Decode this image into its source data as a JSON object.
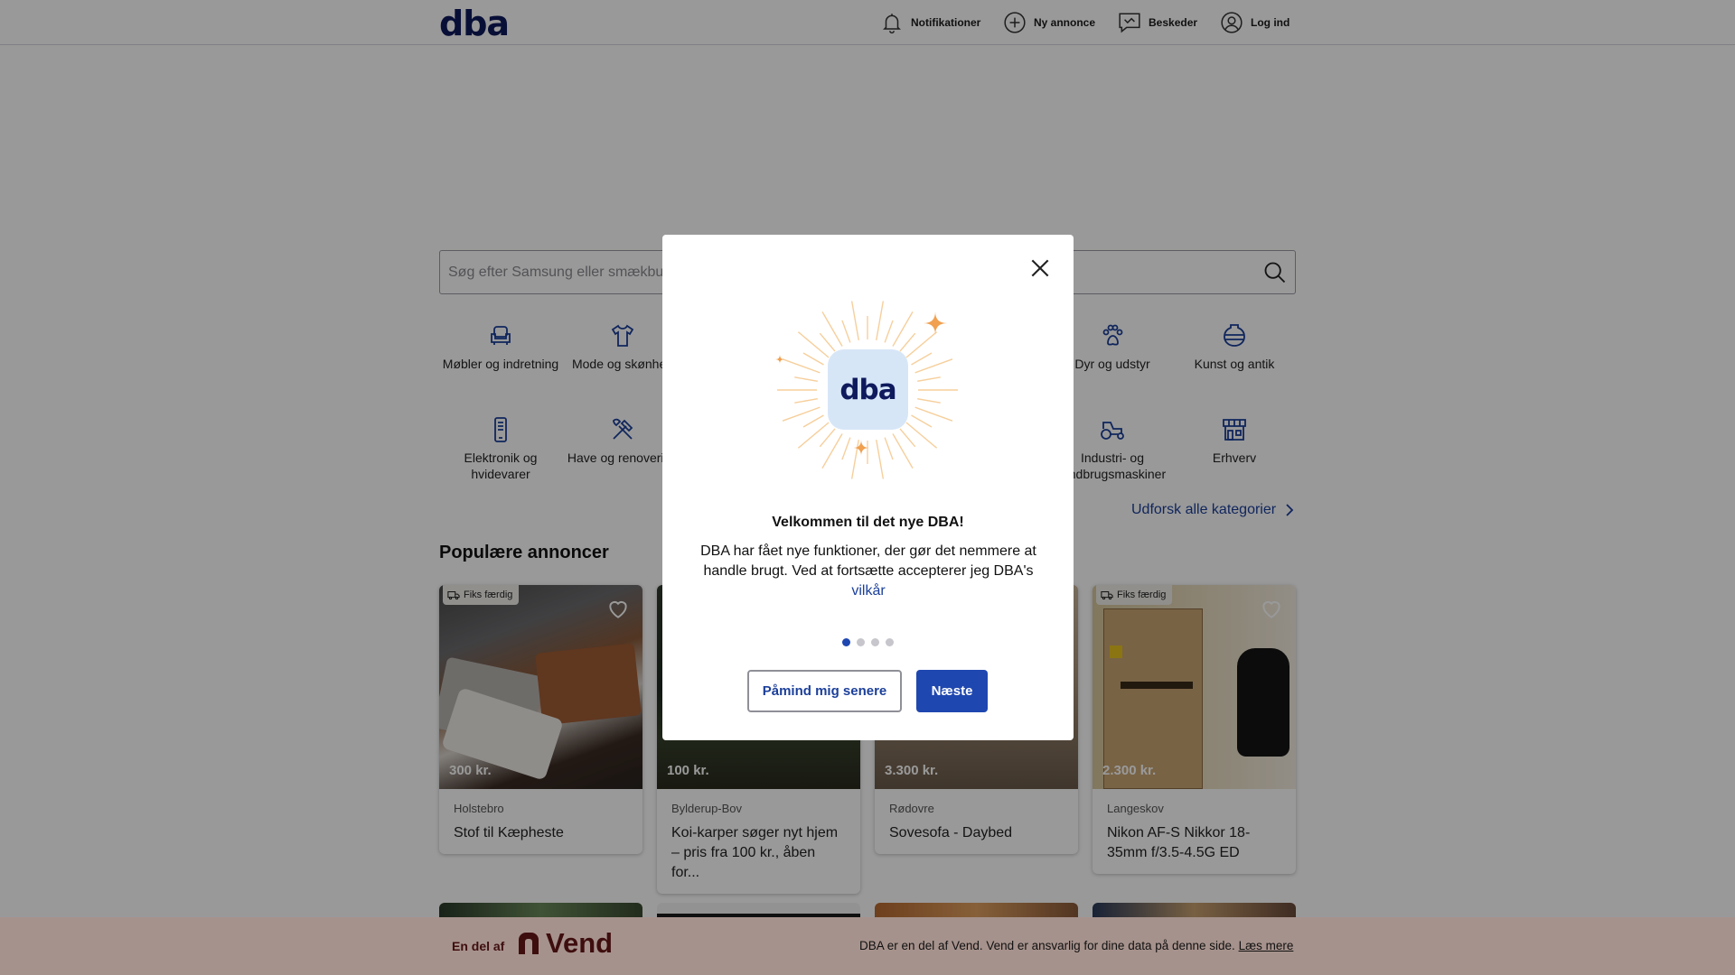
{
  "header": {
    "logo": "dba",
    "nav": [
      {
        "label": "Notifikationer",
        "icon": "bell-icon"
      },
      {
        "label": "Ny annonce",
        "icon": "plus-circle-icon"
      },
      {
        "label": "Beskeder",
        "icon": "message-icon"
      },
      {
        "label": "Log ind",
        "icon": "user-icon"
      }
    ]
  },
  "search": {
    "placeholder": "Søg efter Samsung eller smækbukser"
  },
  "categories": [
    {
      "label": "Møbler og indretning",
      "icon": "armchair-icon"
    },
    {
      "label": "Mode og skønhed",
      "icon": "tshirt-icon"
    },
    {
      "label": "Dyr og udstyr",
      "icon": "paw-icon"
    },
    {
      "label": "Kunst og antik",
      "icon": "vase-icon"
    },
    {
      "label": "Elektronik og hvidevarer",
      "icon": "phone-icon"
    },
    {
      "label": "Have og renovering",
      "icon": "tools-icon"
    },
    {
      "label": "Industri- og landbrugsmaskiner",
      "icon": "tractor-icon"
    },
    {
      "label": "Erhverv",
      "icon": "store-icon"
    }
  ],
  "explore_label": "Udforsk alle kategorier",
  "popular": {
    "title": "Populære annoncer",
    "badge_label": "Fiks færdig",
    "cards": [
      {
        "price": "300 kr.",
        "location": "Holstebro",
        "title": "Stof til Kæpheste",
        "badge": true
      },
      {
        "price": "100 kr.",
        "location": "Bylderup-Bov",
        "title": "Koi-karper søger nyt hjem – pris fra 100 kr., åben for...",
        "badge": false
      },
      {
        "price": "3.300 kr.",
        "location": "Rødovre",
        "title": "Sovesofa - Daybed",
        "badge": false
      },
      {
        "price": "2.300 kr.",
        "location": "Langeskov",
        "title": "Nikon AF-S Nikkor 18-35mm f/3.5-4.5G ED",
        "badge": true
      }
    ]
  },
  "footer": {
    "part_of": "En del af",
    "brand": "Vend",
    "message": "DBA er en del af Vend. Vend er ansvarlig for dine data på denne side.",
    "link": "Læs mere"
  },
  "modal": {
    "title": "Velkommen til det nye DBA!",
    "body": "DBA har fået nye funktioner, der gør det nemmere at handle brugt. Ved at fortsætte accepterer jeg DBA's",
    "terms_link": "vilkår",
    "logo": "dba",
    "step": 1,
    "steps_total": 4,
    "remind_label": "Påmind mig senere",
    "next_label": "Næste"
  },
  "colors": {
    "brand_navy": "#0e1a5c",
    "primary_blue": "#1f47b0",
    "link_blue": "#1b3f9a",
    "vend_red": "#6a1b1b",
    "footer_bg": "#e5d6d1",
    "sparkle_orange": "#f0a050"
  }
}
